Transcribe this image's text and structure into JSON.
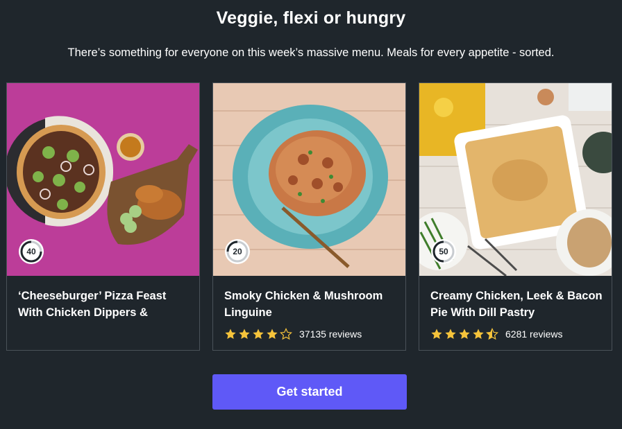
{
  "heading": "Veggie, flexi or hungry",
  "subheading": "There’s something for everyone on this week’s massive menu. Meals for every appetite - sorted.",
  "cards": [
    {
      "title": "‘Cheeseburger’ Pizza Feast With Chicken Dippers &",
      "time": "40",
      "rating": null,
      "reviews": ""
    },
    {
      "title": "Smoky Chicken & Mushroom Linguine",
      "time": "20",
      "rating": 4,
      "reviews": "37135 reviews"
    },
    {
      "title": "Creamy Chicken, Leek & Bacon Pie With Dill Pastry",
      "time": "50",
      "rating": 4.5,
      "reviews": "6281 reviews"
    }
  ],
  "cta_label": "Get started",
  "colors": {
    "background": "#1f262c",
    "accent": "#5f59f7",
    "star": "#f5c33b"
  }
}
